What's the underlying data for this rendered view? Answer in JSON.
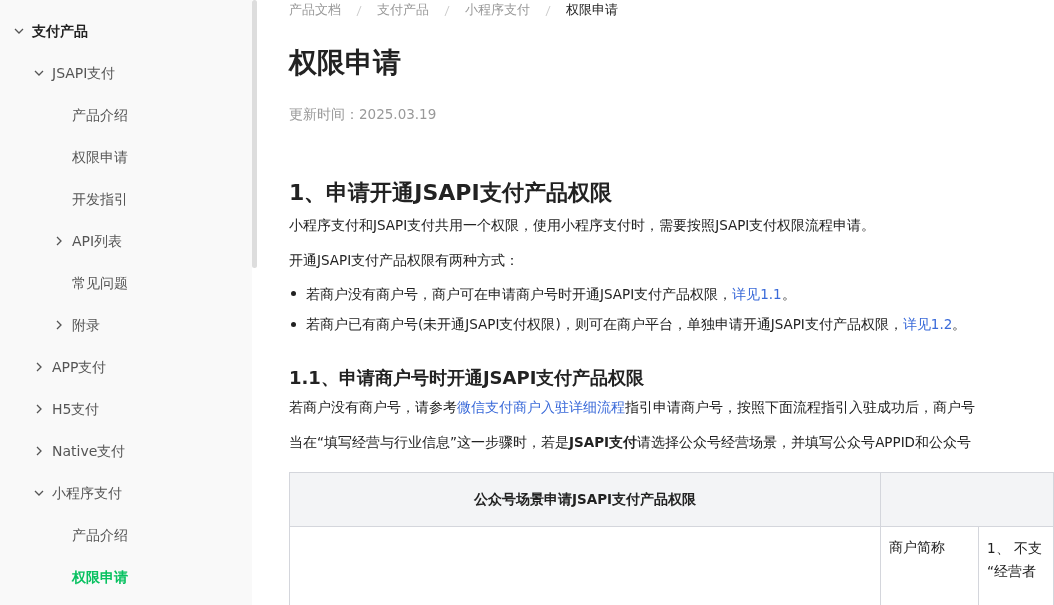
{
  "sidebar": {
    "tree": [
      {
        "label": "支付产品",
        "expanded": true,
        "selected": false,
        "children": [
          {
            "label": "JSAPI支付",
            "expanded": true,
            "selected": false,
            "children": [
              {
                "label": "产品介绍",
                "selected": false
              },
              {
                "label": "权限申请",
                "selected": false
              },
              {
                "label": "开发指引",
                "selected": false
              },
              {
                "label": "API列表",
                "expanded": false,
                "selected": false
              },
              {
                "label": "常见问题",
                "selected": false
              },
              {
                "label": "附录",
                "expanded": false,
                "selected": false
              }
            ]
          },
          {
            "label": "APP支付",
            "expanded": false,
            "selected": false
          },
          {
            "label": "H5支付",
            "expanded": false,
            "selected": false
          },
          {
            "label": "Native支付",
            "expanded": false,
            "selected": false
          },
          {
            "label": "小程序支付",
            "expanded": true,
            "selected": false,
            "children": [
              {
                "label": "产品介绍",
                "selected": false
              },
              {
                "label": "权限申请",
                "selected": true
              }
            ]
          }
        ]
      }
    ]
  },
  "breadcrumb": [
    "产品文档",
    "支付产品",
    "小程序支付",
    "权限申请"
  ],
  "title": "权限申请",
  "updated": "更新时间：2025.03.19",
  "sections": [
    {
      "heading": "1、申请开通JSAPI支付产品权限",
      "kind": "section",
      "paragraphs": [
        {
          "kind": "text",
          "text": "小程序支付和JSAPI支付共用一个权限，使用小程序支付时，需要按照JSAPI支付权限流程申请。"
        },
        {
          "kind": "text",
          "text": "开通JSAPI支付产品权限有两种方式："
        },
        {
          "kind": "bullet",
          "text": "若商户没有商户号，商户可在申请商户号时开通JSAPI支付产品权限，",
          "link": "详见1.1",
          "after": "。"
        },
        {
          "kind": "bullet",
          "text": "若商户已有商户号(未开通JSAPI支付权限)，则可在商户平台，单独申请开通JSAPI支付产品权限，",
          "link": "详见1.2",
          "after": "。"
        }
      ]
    },
    {
      "heading": "1.1、申请商户号时开通JSAPI支付产品权限",
      "kind": "subsection",
      "paragraphs": [
        {
          "kind": "text",
          "text": "若商户没有商户号，请参考",
          "link": "微信支付商户入驻详细流程",
          "after": "指引申请商户号，按照下面流程指引入驻成功后，商户号"
        },
        {
          "kind": "text",
          "text": "当在“填写经营与行业信息”这一步骤时，若是**JSAPI支付**请选择公众号经营场景，并填写公众号APPID和公众号"
        }
      ]
    }
  ],
  "table": {
    "header": "公众号场景申请JSAPI支付产品权限",
    "rows": [
      {
        "column_2": "商户简称",
        "column_3": [
          "1、 不支",
          "“经营者"
        ]
      }
    ]
  }
}
